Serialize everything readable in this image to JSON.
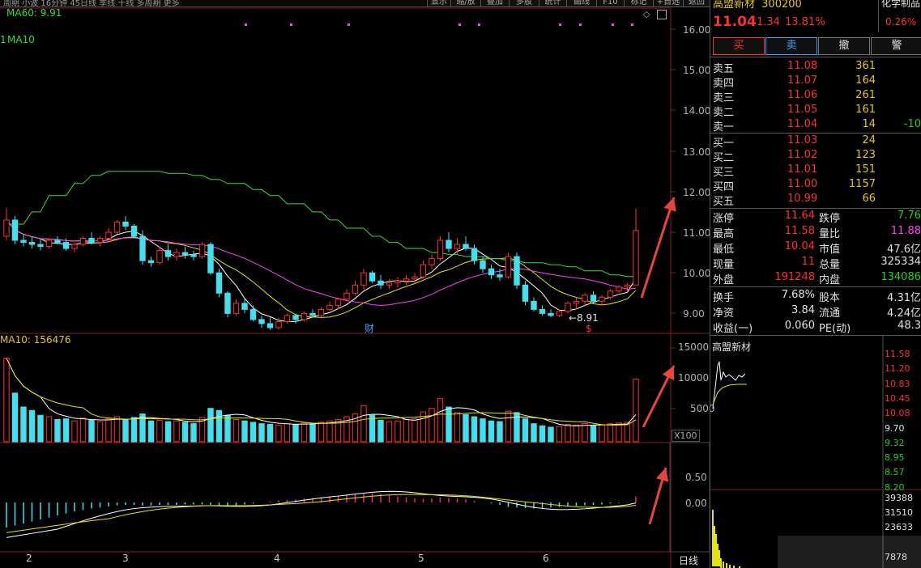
{
  "toolbar": {
    "left_text": "周期  小波  16分钟  45日线  季线  干线  多周期  更多",
    "buttons": [
      "显示",
      "缩/放",
      "叠加",
      "多股",
      "统计",
      "画线",
      "F10",
      "标记",
      "+自选",
      "返回"
    ]
  },
  "main_chart": {
    "ma60_label": "MA60: 9.91",
    "y_ticks": [
      "16.00",
      "15.00",
      "14.00",
      "13.00",
      "12.00",
      "11.00",
      "10.00",
      "9.00"
    ],
    "low_annotation": "←8.91",
    "finance_marker": "财",
    "dividend_marker": "$",
    "marker_left": "1",
    "ma_label_left": "MA10"
  },
  "volume_chart": {
    "label": "MA10: 156476",
    "y_ticks": [
      "15000",
      "10000",
      "5000"
    ],
    "unit": "X100"
  },
  "macd_chart": {
    "y_ticks": [
      "0.50",
      "0.00"
    ]
  },
  "x_axis": {
    "labels": [
      "2",
      "3",
      "4",
      "5",
      "6"
    ],
    "period_label": "日线"
  },
  "quote": {
    "name": "高盟新材",
    "code": "300200",
    "price": "11.04",
    "change": "1.34",
    "change_pct": "13.81%",
    "sector": "化学制品",
    "sector_pct": "0.26%"
  },
  "trade_buttons": [
    "买",
    "卖",
    "撤",
    "警"
  ],
  "order_book": {
    "asks": [
      {
        "label": "卖五",
        "price": "11.08",
        "vol": "361",
        "chg": ""
      },
      {
        "label": "卖四",
        "price": "11.07",
        "vol": "164",
        "chg": ""
      },
      {
        "label": "卖三",
        "price": "11.06",
        "vol": "261",
        "chg": ""
      },
      {
        "label": "卖二",
        "price": "11.05",
        "vol": "161",
        "chg": ""
      },
      {
        "label": "卖一",
        "price": "11.04",
        "vol": "14",
        "chg": "-10"
      }
    ],
    "bids": [
      {
        "label": "买一",
        "price": "11.03",
        "vol": "24"
      },
      {
        "label": "买二",
        "price": "11.02",
        "vol": "123"
      },
      {
        "label": "买三",
        "price": "11.01",
        "vol": "151"
      },
      {
        "label": "买四",
        "price": "11.00",
        "vol": "1157"
      },
      {
        "label": "买五",
        "price": "10.99",
        "vol": "66"
      }
    ]
  },
  "stats": [
    {
      "l1": "涨停",
      "v1": "11.64",
      "c1": "red",
      "l2": "跌停",
      "v2": "7.76",
      "c2": "grn"
    },
    {
      "l1": "最高",
      "v1": "11.58",
      "c1": "red",
      "l2": "量比",
      "v2": "11.88",
      "c2": "mag"
    },
    {
      "l1": "最低",
      "v1": "10.04",
      "c1": "red",
      "l2": "市值",
      "v2": "47.6亿",
      "c2": "wht"
    },
    {
      "l1": "现量",
      "v1": "11",
      "c1": "red",
      "l2": "总量",
      "v2": "325334",
      "c2": "wht"
    },
    {
      "l1": "外盘",
      "v1": "191248",
      "c1": "red",
      "l2": "内盘",
      "v2": "134086",
      "c2": "grn"
    }
  ],
  "stats2": [
    {
      "l1": "换手",
      "v1": "7.68%",
      "l2": "股本",
      "v2": "4.31亿"
    },
    {
      "l1": "净资",
      "v1": "3.84",
      "l2": "流通",
      "v2": "4.24亿"
    },
    {
      "l1": "收益(一)",
      "v1": "0.060",
      "l2": "PE(动)",
      "v2": "48.3"
    }
  ],
  "mini_chart": {
    "title": "高盟新材",
    "price_ticks": [
      {
        "v": "11.58",
        "c": "#ff3030"
      },
      {
        "v": "11.20",
        "c": "#ff3030"
      },
      {
        "v": "10.83",
        "c": "#ff3030"
      },
      {
        "v": "10.45",
        "c": "#ff3030"
      },
      {
        "v": "10.08",
        "c": "#ff3030"
      },
      {
        "v": "9.70",
        "c": "#e0e0e0"
      },
      {
        "v": "9.32",
        "c": "#20d020"
      },
      {
        "v": "8.95",
        "c": "#20d020"
      },
      {
        "v": "8.57",
        "c": "#20d020"
      },
      {
        "v": "8.20",
        "c": "#20d020"
      }
    ],
    "vol_ticks": [
      "39388",
      "31510",
      "23633",
      "7878"
    ]
  },
  "colors": {
    "up": "#ff3030",
    "down": "#40e0f0",
    "ma5": "#ffffff",
    "ma10": "#e6e600",
    "ma20": "#ff40ff",
    "ma60": "#30e030",
    "grid": "#8a1c1c",
    "arrow": "#e8463c"
  },
  "chart_data": {
    "type": "candlestick",
    "price_ylim": [
      8.5,
      16.3
    ],
    "candles": [
      [
        10.9,
        11.6,
        10.8,
        11.3
      ],
      [
        11.3,
        11.4,
        10.7,
        10.8
      ],
      [
        10.8,
        10.95,
        10.65,
        10.75
      ],
      [
        10.75,
        10.9,
        10.6,
        10.7
      ],
      [
        10.7,
        10.85,
        10.55,
        10.65
      ],
      [
        10.65,
        10.85,
        10.6,
        10.8
      ],
      [
        10.8,
        10.9,
        10.7,
        10.75
      ],
      [
        10.75,
        10.85,
        10.55,
        10.6
      ],
      [
        10.6,
        10.75,
        10.5,
        10.7
      ],
      [
        10.7,
        10.9,
        10.65,
        10.85
      ],
      [
        10.85,
        11.0,
        10.7,
        10.75
      ],
      [
        10.75,
        10.9,
        10.65,
        10.85
      ],
      [
        10.85,
        11.1,
        10.8,
        11.0
      ],
      [
        11.0,
        11.3,
        10.95,
        11.25
      ],
      [
        11.25,
        11.4,
        11.05,
        11.15
      ],
      [
        11.15,
        11.2,
        10.85,
        10.9
      ],
      [
        10.9,
        11.05,
        10.2,
        10.3
      ],
      [
        10.3,
        10.4,
        10.15,
        10.25
      ],
      [
        10.25,
        10.65,
        10.2,
        10.55
      ],
      [
        10.55,
        10.7,
        10.3,
        10.4
      ],
      [
        10.4,
        10.6,
        10.3,
        10.5
      ],
      [
        10.5,
        10.65,
        10.35,
        10.45
      ],
      [
        10.45,
        10.55,
        10.3,
        10.4
      ],
      [
        10.4,
        10.75,
        10.35,
        10.7
      ],
      [
        10.7,
        10.75,
        9.95,
        10.0
      ],
      [
        10.0,
        10.1,
        9.4,
        9.5
      ],
      [
        9.5,
        9.55,
        8.9,
        9.0
      ],
      [
        9.0,
        9.35,
        8.95,
        9.25
      ],
      [
        9.25,
        9.35,
        9.0,
        9.1
      ],
      [
        9.1,
        9.2,
        8.8,
        8.85
      ],
      [
        8.85,
        8.95,
        8.65,
        8.75
      ],
      [
        8.75,
        8.9,
        8.6,
        8.65
      ],
      [
        8.65,
        8.9,
        8.6,
        8.8
      ],
      [
        8.8,
        9.0,
        8.75,
        8.95
      ],
      [
        8.95,
        9.0,
        8.75,
        8.85
      ],
      [
        8.85,
        9.05,
        8.8,
        9.0
      ],
      [
        9.0,
        9.1,
        8.9,
        8.95
      ],
      [
        8.95,
        9.15,
        8.9,
        9.1
      ],
      [
        9.1,
        9.3,
        9.05,
        9.2
      ],
      [
        9.2,
        9.4,
        9.1,
        9.35
      ],
      [
        9.35,
        9.6,
        9.3,
        9.5
      ],
      [
        9.5,
        9.8,
        9.45,
        9.7
      ],
      [
        9.7,
        10.1,
        9.6,
        10.0
      ],
      [
        10.0,
        10.05,
        9.75,
        9.8
      ],
      [
        9.8,
        9.95,
        9.6,
        9.7
      ],
      [
        9.7,
        9.85,
        9.6,
        9.75
      ],
      [
        9.75,
        9.9,
        9.65,
        9.8
      ],
      [
        9.8,
        9.95,
        9.7,
        9.85
      ],
      [
        9.85,
        10.0,
        9.75,
        9.9
      ],
      [
        9.9,
        10.3,
        9.85,
        10.2
      ],
      [
        10.2,
        10.45,
        10.1,
        10.35
      ],
      [
        10.35,
        10.9,
        10.3,
        10.8
      ],
      [
        10.8,
        11.0,
        10.5,
        10.6
      ],
      [
        10.6,
        10.85,
        10.45,
        10.7
      ],
      [
        10.7,
        10.9,
        10.55,
        10.6
      ],
      [
        10.6,
        10.7,
        10.2,
        10.3
      ],
      [
        10.3,
        10.4,
        10.0,
        10.1
      ],
      [
        10.1,
        10.2,
        9.85,
        9.95
      ],
      [
        9.95,
        10.1,
        9.8,
        9.9
      ],
      [
        9.9,
        10.5,
        9.85,
        10.4
      ],
      [
        10.4,
        10.5,
        9.6,
        9.7
      ],
      [
        9.7,
        9.8,
        9.2,
        9.3
      ],
      [
        9.3,
        9.4,
        9.05,
        9.1
      ],
      [
        9.1,
        9.2,
        8.95,
        9.0
      ],
      [
        9.0,
        9.1,
        8.91,
        8.95
      ],
      [
        8.95,
        9.1,
        8.91,
        9.05
      ],
      [
        9.05,
        9.3,
        9.0,
        9.25
      ],
      [
        9.25,
        9.4,
        9.1,
        9.3
      ],
      [
        9.3,
        9.5,
        9.2,
        9.45
      ],
      [
        9.45,
        9.55,
        9.25,
        9.3
      ],
      [
        9.3,
        9.45,
        9.2,
        9.4
      ],
      [
        9.4,
        9.6,
        9.35,
        9.55
      ],
      [
        9.55,
        9.7,
        9.5,
        9.65
      ],
      [
        9.65,
        9.75,
        9.55,
        9.7
      ],
      [
        9.7,
        11.58,
        9.7,
        11.04
      ]
    ],
    "volumes": [
      12000,
      7000,
      5000,
      4500,
      3800,
      3600,
      3200,
      3300,
      3000,
      3400,
      3100,
      2900,
      3300,
      3600,
      3200,
      3500,
      4000,
      3000,
      3100,
      2900,
      3000,
      2800,
      2600,
      3500,
      4800,
      4500,
      3800,
      3200,
      3000,
      2800,
      2600,
      2500,
      2400,
      2600,
      2500,
      2700,
      2600,
      2800,
      3000,
      3200,
      3600,
      4000,
      5200,
      3800,
      3100,
      2900,
      3000,
      3200,
      3300,
      4300,
      4800,
      6200,
      5000,
      4200,
      3900,
      3600,
      3300,
      3000,
      2900,
      4400,
      4200,
      3300,
      2600,
      2300,
      2100,
      2200,
      2500,
      2400,
      2600,
      2300,
      2400,
      2600,
      2700,
      2800,
      9000
    ],
    "macd": [
      -0.5,
      -0.46,
      -0.42,
      -0.38,
      -0.34,
      -0.3,
      -0.26,
      -0.22,
      -0.18,
      -0.15,
      -0.12,
      -0.1,
      -0.08,
      -0.06,
      -0.05,
      -0.05,
      -0.06,
      -0.06,
      -0.05,
      -0.05,
      -0.05,
      -0.04,
      -0.04,
      -0.04,
      -0.05,
      -0.07,
      -0.08,
      -0.06,
      -0.04,
      -0.02,
      0.0,
      0.02,
      0.04,
      0.05,
      0.06,
      0.08,
      0.09,
      0.11,
      0.12,
      0.13,
      0.15,
      0.16,
      0.17,
      0.18,
      0.17,
      0.15,
      0.12,
      0.1,
      0.08,
      0.07,
      0.08,
      0.1,
      0.09,
      0.08,
      0.06,
      0.03,
      0.0,
      -0.02,
      -0.05,
      -0.09,
      -0.1,
      -0.11,
      -0.12,
      -0.11,
      -0.1,
      -0.09,
      -0.08,
      -0.07,
      -0.06,
      -0.05,
      -0.04,
      -0.02,
      -0.01,
      0.01,
      0.12
    ]
  }
}
